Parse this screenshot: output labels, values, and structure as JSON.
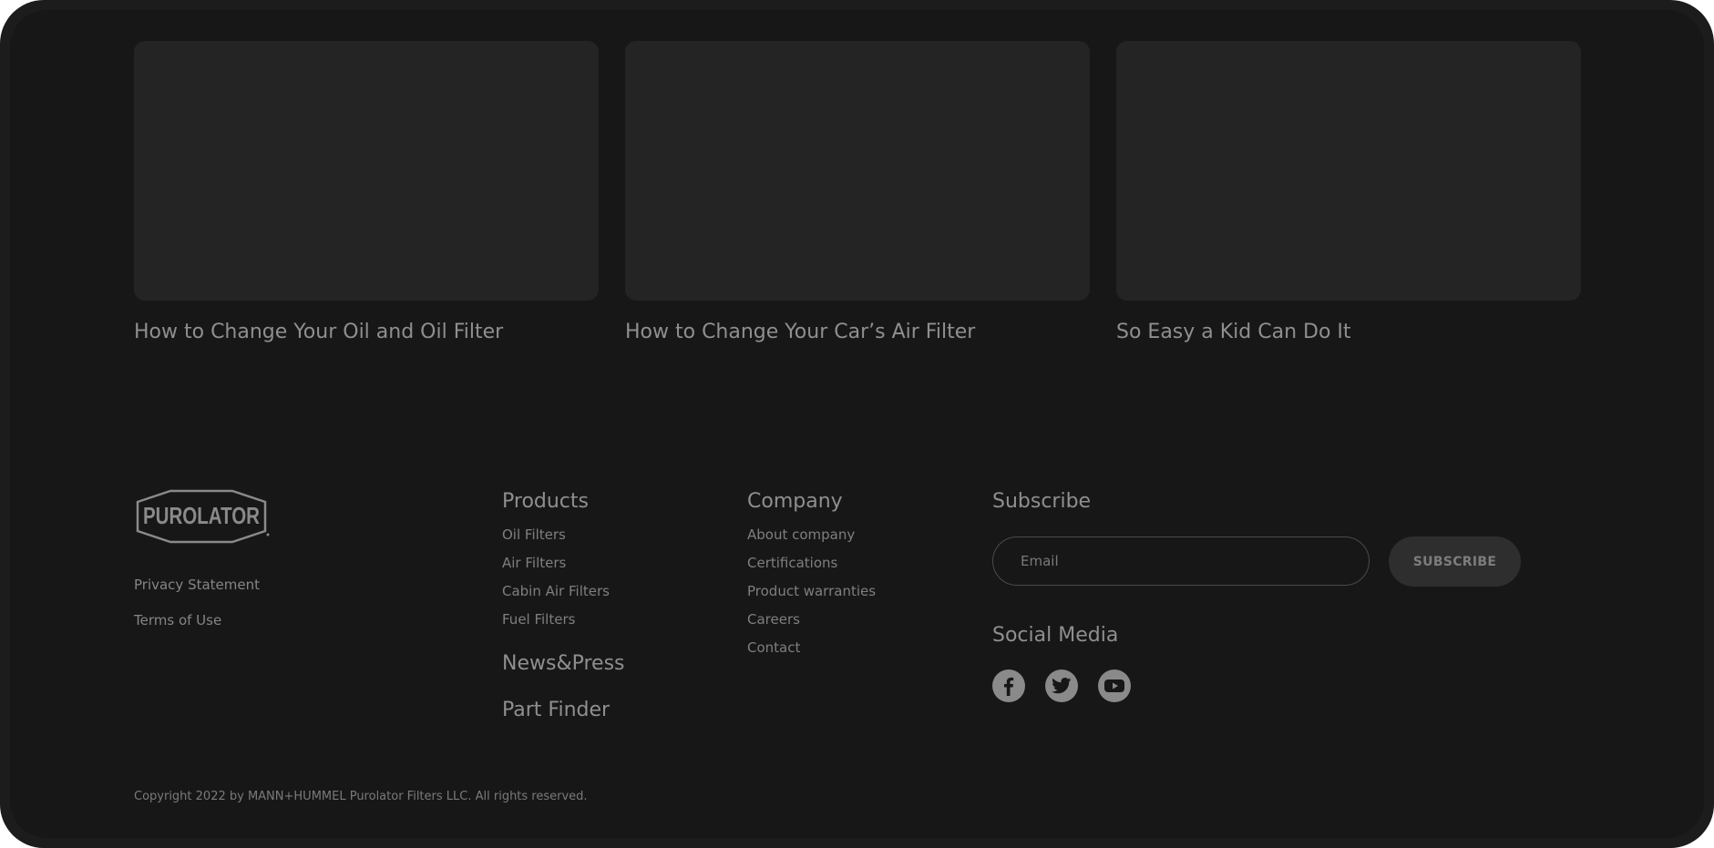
{
  "articles": [
    {
      "title": "How to Change Your Oil and Oil Filter"
    },
    {
      "title": "How to Change Your Car’s Air Filter"
    },
    {
      "title": "So Easy a Kid Can Do It"
    }
  ],
  "footer": {
    "logo_text": "PUROLATOR",
    "legal": {
      "privacy": "Privacy Statement",
      "terms": "Terms of Use"
    },
    "products": {
      "heading": "Products",
      "links": [
        "Oil Filters",
        "Air Filters",
        "Cabin Air Filters",
        "Fuel Filters"
      ]
    },
    "news_press": "News&Press",
    "part_finder": "Part Finder",
    "company": {
      "heading": "Company",
      "links": [
        "About company",
        "Certifications",
        "Product warranties",
        "Careers",
        "Contact"
      ]
    },
    "subscribe": {
      "heading": "Subscribe",
      "email_placeholder": "Email",
      "button_label": "SUBSCRIBE"
    },
    "social": {
      "heading": "Social Media",
      "icons": [
        "facebook-icon",
        "twitter-icon",
        "youtube-icon"
      ]
    },
    "copyright": "Copyright 2022 by MANN+HUMMEL Purolator Filters LLC. All rights reserved."
  },
  "colors": {
    "background": "#171717",
    "card": "#242424",
    "text": "#8f8f8f",
    "button": "#2e2e2e"
  }
}
